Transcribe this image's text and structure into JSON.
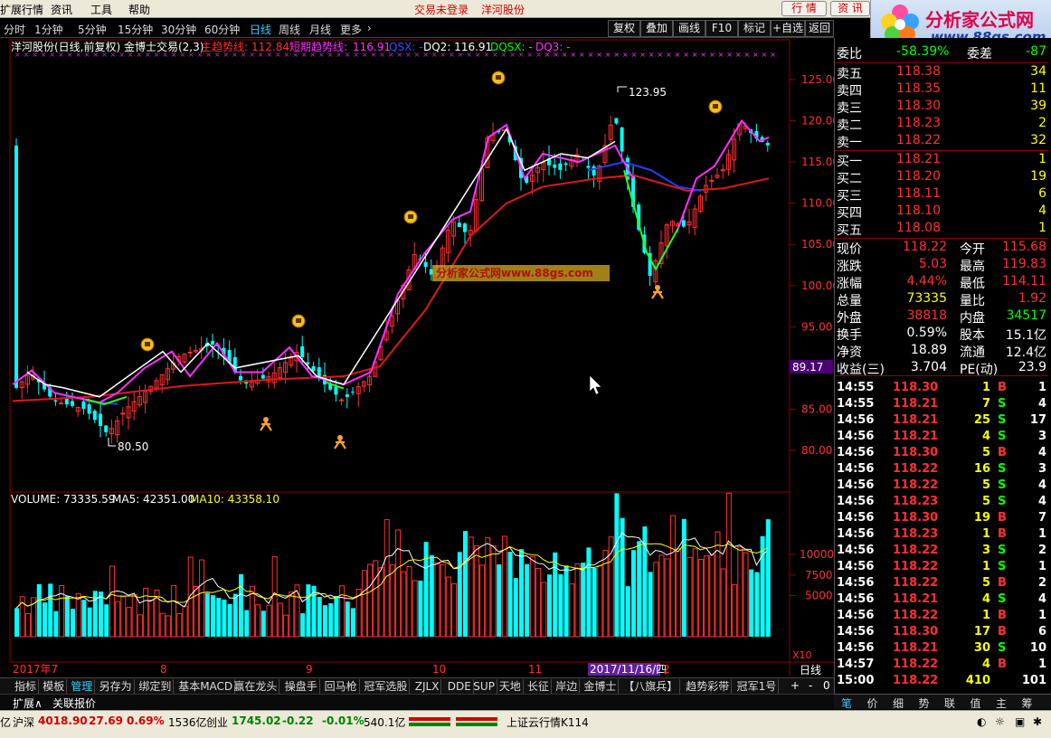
{
  "menubar": {
    "items": [
      "扩展行情",
      "资讯",
      "工具",
      "帮助"
    ],
    "status": "交易未登录",
    "stock": "洋河股份",
    "btn_quote": "行 情",
    "btn_news": "资 讯"
  },
  "logo": {
    "name": "分析家公式网",
    "url": "www.88gs.com"
  },
  "toolbar": {
    "periods": [
      "分时",
      "1分钟",
      "5分钟",
      "15分钟",
      "30分钟",
      "60分钟",
      "日线",
      "周线",
      "月线",
      "更多"
    ],
    "buttons": [
      "复权",
      "叠加",
      "画线",
      "F10",
      "标记",
      "+自选",
      "返回"
    ]
  },
  "chart": {
    "title": "洋河股份(日线,前复权) 金博士交易(2,3)",
    "ind_main_label": "主趋势线:",
    "ind_main_val": "112.84",
    "ind_short_label": "短期趋势线:",
    "ind_short_val": "116.91",
    "ind_qsx": "QSX: -",
    "ind_dq2": "DQ2: 116.91",
    "ind_dqsx": "DQSX: -",
    "ind_dq3": "DQ3: -",
    "high_label": "123.95",
    "low_label": "80.50",
    "crosshair_price": "89.17",
    "watermark": "分析家公式网www.88gs.com",
    "volume_label": "VOLUME: 73335.59",
    "ma5_label": "MA5: 42351.00",
    "ma10_label": "MA10: 43358.10",
    "vol_unit": "X10",
    "x_date_labels": [
      "2017年7",
      "8",
      "9",
      "10",
      "11",
      "2"
    ],
    "cursor_date": "2017/11/16/四",
    "period_label": "日线"
  },
  "chart_data": {
    "type": "line",
    "price_ticks": [
      125.0,
      120.0,
      115.0,
      110.0,
      105.0,
      100.0,
      95.0,
      90.0,
      85.0,
      80.0
    ],
    "volume_ticks": [
      10000,
      7500,
      5000
    ],
    "ylim": [
      77,
      128
    ],
    "vol_ylim": [
      0,
      16000
    ],
    "main_trend_value": 112.84,
    "short_trend_value": 116.91,
    "high": 123.95,
    "low": 80.5
  },
  "quote": {
    "weibi_label": "委比",
    "weibi": "-58.39%",
    "weicha_label": "委差",
    "weicha": "-87",
    "asks": [
      {
        "label": "卖五",
        "price": "118.38",
        "vol": "34"
      },
      {
        "label": "卖四",
        "price": "118.35",
        "vol": "11"
      },
      {
        "label": "卖三",
        "price": "118.30",
        "vol": "39"
      },
      {
        "label": "卖二",
        "price": "118.23",
        "vol": "2"
      },
      {
        "label": "卖一",
        "price": "118.22",
        "vol": "32"
      }
    ],
    "bids": [
      {
        "label": "买一",
        "price": "118.21",
        "vol": "1"
      },
      {
        "label": "买二",
        "price": "118.20",
        "vol": "19"
      },
      {
        "label": "买三",
        "price": "118.11",
        "vol": "6"
      },
      {
        "label": "买四",
        "price": "118.10",
        "vol": "4"
      },
      {
        "label": "买五",
        "price": "118.08",
        "vol": "1"
      }
    ],
    "stats": [
      {
        "l1": "现价",
        "v1": "118.22",
        "c1": "#ff3030",
        "l2": "今开",
        "v2": "115.68",
        "c2": "#ff3030"
      },
      {
        "l1": "涨跌",
        "v1": "5.03",
        "c1": "#ff3030",
        "l2": "最高",
        "v2": "119.83",
        "c2": "#ff3030"
      },
      {
        "l1": "涨幅",
        "v1": "4.44%",
        "c1": "#ff3030",
        "l2": "最低",
        "v2": "114.11",
        "c2": "#ff3030"
      },
      {
        "l1": "总量",
        "v1": "73335",
        "c1": "#ffff00",
        "l2": "量比",
        "v2": "1.92",
        "c2": "#ff3030"
      },
      {
        "l1": "外盘",
        "v1": "38818",
        "c1": "#ff3030",
        "l2": "内盘",
        "v2": "34517",
        "c2": "#00ff00"
      },
      {
        "l1": "换手",
        "v1": "0.59%",
        "c1": "#ffffff",
        "l2": "股本",
        "v2": "15.1亿",
        "c2": "#ffffff"
      },
      {
        "l1": "净资",
        "v1": "18.89",
        "c1": "#ffffff",
        "l2": "流通",
        "v2": "12.4亿",
        "c2": "#ffffff"
      },
      {
        "l1": "收益(三)",
        "v1": "3.704",
        "c1": "#ffffff",
        "l2": "PE(动)",
        "v2": "23.9",
        "c2": "#ffffff"
      }
    ],
    "ticks": [
      {
        "time": "14:55",
        "price": "118.30",
        "vol": "1",
        "bs": "B",
        "n": "1"
      },
      {
        "time": "14:55",
        "price": "118.21",
        "vol": "7",
        "bs": "S",
        "n": "4"
      },
      {
        "time": "14:56",
        "price": "118.21",
        "vol": "25",
        "bs": "S",
        "n": "17"
      },
      {
        "time": "14:56",
        "price": "118.21",
        "vol": "4",
        "bs": "S",
        "n": "3"
      },
      {
        "time": "14:56",
        "price": "118.30",
        "vol": "5",
        "bs": "B",
        "n": "4"
      },
      {
        "time": "14:56",
        "price": "118.22",
        "vol": "16",
        "bs": "S",
        "n": "3"
      },
      {
        "time": "14:56",
        "price": "118.22",
        "vol": "5",
        "bs": "S",
        "n": "4"
      },
      {
        "time": "14:56",
        "price": "118.23",
        "vol": "5",
        "bs": "S",
        "n": "4"
      },
      {
        "time": "14:56",
        "price": "118.30",
        "vol": "19",
        "bs": "B",
        "n": "7"
      },
      {
        "time": "14:56",
        "price": "118.23",
        "vol": "1",
        "bs": "B",
        "n": "1"
      },
      {
        "time": "14:56",
        "price": "118.22",
        "vol": "3",
        "bs": "S",
        "n": "2"
      },
      {
        "time": "14:56",
        "price": "118.22",
        "vol": "1",
        "bs": "S",
        "n": "1"
      },
      {
        "time": "14:56",
        "price": "118.22",
        "vol": "5",
        "bs": "B",
        "n": "2"
      },
      {
        "time": "14:56",
        "price": "118.21",
        "vol": "4",
        "bs": "S",
        "n": "4"
      },
      {
        "time": "14:56",
        "price": "118.22",
        "vol": "1",
        "bs": "B",
        "n": "1"
      },
      {
        "time": "14:56",
        "price": "118.30",
        "vol": "17",
        "bs": "B",
        "n": "6"
      },
      {
        "time": "14:56",
        "price": "118.21",
        "vol": "30",
        "bs": "S",
        "n": "10"
      },
      {
        "time": "14:57",
        "price": "118.22",
        "vol": "4",
        "bs": "B",
        "n": "1"
      },
      {
        "time": "15:00",
        "price": "118.22",
        "vol": "410",
        "bs": "",
        "n": "101"
      }
    ],
    "right_tabs": [
      "笔",
      "价",
      "细",
      "势",
      "联",
      "值",
      "主",
      "筹"
    ]
  },
  "tabs": [
    "指标",
    "模板",
    "管理",
    "另存为",
    "绑定到",
    "基本MACD",
    "赢在龙头",
    "操盘手",
    "回马枪",
    "冠军选股",
    "ZJLX",
    "DDE",
    "SUP",
    "天地",
    "长征",
    "岸边",
    "金博士",
    "【八旗兵】",
    "趋势彩带",
    "冠军1号"
  ],
  "tabs2": [
    "扩展∧",
    "关联报价"
  ],
  "statusbar": {
    "prefix": "亿",
    "sh_label": "沪深",
    "sh_val": "4018.90",
    "sh_chg": "27.69",
    "sh_pct": "0.69%",
    "sh_amt": "1536亿",
    "cy_label": "创业",
    "cy_val": "1745.02",
    "cy_chg": "-0.22",
    "cy_pct": "-0.01%",
    "cy_amt": "540.1亿",
    "cloud": "上证云行情K114"
  },
  "colors": {
    "up": "#ff3030",
    "down": "#00ffff",
    "ma_red": "#e01818",
    "ma_blue": "#2040ff",
    "trend_magenta": "#ff30ff",
    "trend_white": "#ffffff",
    "trend_green": "#20ff20",
    "grid": "#8b0000"
  }
}
